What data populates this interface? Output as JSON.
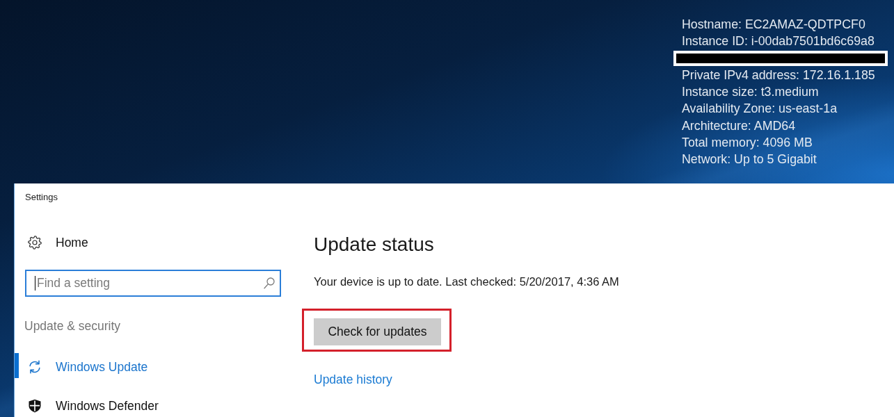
{
  "desktop": {
    "info_lines": [
      {
        "kind": "text",
        "text": "Hostname: EC2AMAZ-QDTPCF0"
      },
      {
        "kind": "text",
        "text": "Instance ID: i-00dab7501bd6c69a8"
      },
      {
        "kind": "redacted"
      },
      {
        "kind": "text",
        "text": "Private IPv4 address: 172.16.1.185"
      },
      {
        "kind": "text",
        "text": "Instance size: t3.medium"
      },
      {
        "kind": "text",
        "text": "Availability Zone: us-east-1a"
      },
      {
        "kind": "text",
        "text": "Architecture: AMD64"
      },
      {
        "kind": "text",
        "text": "Total memory: 4096 MB"
      },
      {
        "kind": "text",
        "text": "Network: Up to 5 Gigabit"
      }
    ]
  },
  "window": {
    "title": "Settings"
  },
  "sidebar": {
    "home": {
      "label": "Home"
    },
    "search": {
      "placeholder": "Find a setting",
      "focused": true
    },
    "section_title": "Update & security",
    "items": [
      {
        "label": "Windows Update",
        "selected": true
      },
      {
        "label": "Windows Defender",
        "selected": false
      }
    ]
  },
  "main": {
    "heading": "Update status",
    "status": "Your device is up to date. Last checked: 5/20/2017, 4:36 AM",
    "button": {
      "label": "Check for updates",
      "highlighted": true
    },
    "link": "Update history"
  }
}
